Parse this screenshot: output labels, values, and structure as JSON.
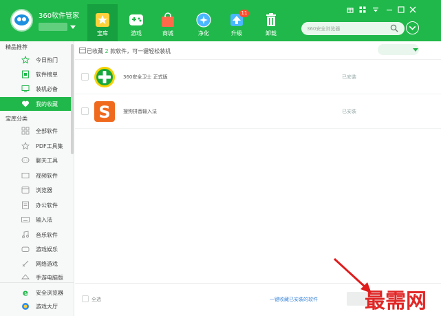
{
  "app": {
    "title": "360软件管家"
  },
  "nav": {
    "items": [
      {
        "label": "宝库",
        "icon": "star-icon"
      },
      {
        "label": "游戏",
        "icon": "gamepad-icon"
      },
      {
        "label": "商城",
        "icon": "bag-icon"
      },
      {
        "label": "净化",
        "icon": "purify-icon"
      },
      {
        "label": "升级",
        "icon": "upgrade-icon",
        "badge": "11"
      },
      {
        "label": "卸载",
        "icon": "trash-icon"
      }
    ]
  },
  "search": {
    "placeholder": "360安全浏览器"
  },
  "sidebar": {
    "section1_title": "精品推荐",
    "recommend": [
      {
        "label": "今日热门",
        "icon": "star-outline-icon"
      },
      {
        "label": "软件榜单",
        "icon": "ranking-icon"
      },
      {
        "label": "装机必备",
        "icon": "monitor-icon"
      },
      {
        "label": "我的收藏",
        "icon": "heart-icon",
        "active": true
      }
    ],
    "section2_title": "宝库分类",
    "categories": [
      {
        "label": "全部软件",
        "icon": "grid-icon"
      },
      {
        "label": "PDF工具集",
        "icon": "star-outline-icon"
      },
      {
        "label": "聊天工具",
        "icon": "chat-icon"
      },
      {
        "label": "视频软件",
        "icon": "video-icon"
      },
      {
        "label": "浏览器",
        "icon": "browser-icon"
      },
      {
        "label": "办公软件",
        "icon": "office-icon"
      },
      {
        "label": "输入法",
        "icon": "keyboard-icon"
      },
      {
        "label": "音乐软件",
        "icon": "music-icon"
      },
      {
        "label": "游戏娱乐",
        "icon": "game-icon"
      },
      {
        "label": "网络游戏",
        "icon": "sword-icon"
      },
      {
        "label": "手游电脑版",
        "icon": "phone-game-icon"
      }
    ],
    "bottom": [
      {
        "label": "安全浏览器",
        "icon": "ie-icon"
      },
      {
        "label": "游戏大厅",
        "icon": "game-hall-icon"
      }
    ]
  },
  "main": {
    "info_prefix": "已收藏",
    "info_count": "2",
    "info_suffix": "款软件，可一键轻松装机",
    "apps": [
      {
        "name": "360安全卫士 正式版",
        "status": "已安装",
        "icon": "360-safe-icon"
      },
      {
        "name": "搜狗拼音输入法",
        "status": "已安装",
        "icon": "sogou-icon"
      }
    ],
    "select_all": "全选",
    "install_link": "一键收藏已安装的软件"
  },
  "watermark": {
    "text": "最需网"
  },
  "colors": {
    "brand": "#20b84a",
    "active_nav": "#16a03f",
    "link": "#3a86d8",
    "annotation": "#e01c1c"
  }
}
